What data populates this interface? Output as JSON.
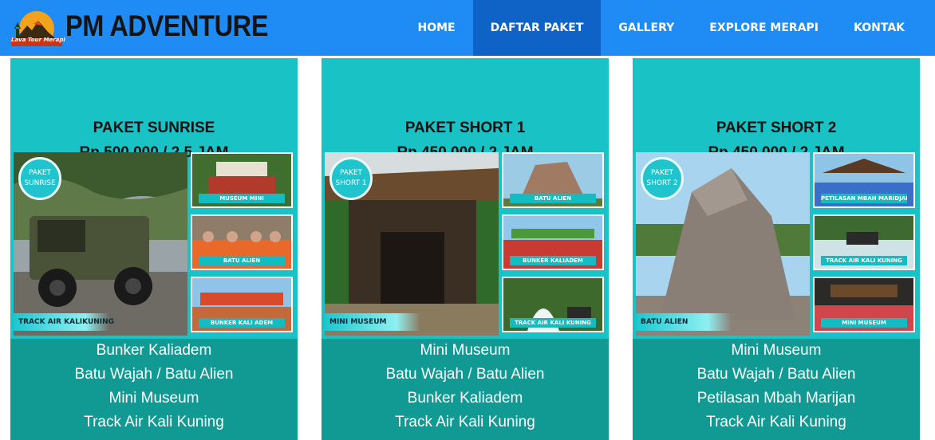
{
  "brand": {
    "name": "PM ADVENTURE",
    "tagline": "Lava Tour Merapi"
  },
  "nav": [
    {
      "label": "HOME",
      "active": false
    },
    {
      "label": "DAFTAR PAKET",
      "active": true
    },
    {
      "label": "GALLERY",
      "active": false
    },
    {
      "label": "EXPLORE MERAPI",
      "active": false
    },
    {
      "label": "KONTAK",
      "active": false
    }
  ],
  "cards": [
    {
      "title": "PAKET SUNRISE",
      "price": "Rp 500.000 / 2,5 JAM",
      "badge": [
        "PAKET",
        "SUNRISE"
      ],
      "main_caption": "TRACK AIR KALIKUNING",
      "thumbs": [
        "MUSEUM MINI",
        "BATU ALIEN",
        "BUNKER KALI ADEM"
      ],
      "items": [
        "Bunker Kaliadem",
        "Batu Wajah / Batu Alien",
        "Mini Museum",
        "Track Air Kali Kuning"
      ]
    },
    {
      "title": "PAKET SHORT 1",
      "price": "Rp 450.000 / 2 JAM",
      "badge": [
        "PAKET",
        "SHORT 1"
      ],
      "main_caption": "MINI MUSEUM",
      "thumbs": [
        "BATU ALIEN",
        "BUNKER KALIADEM",
        "TRACK AIR KALI KUNING"
      ],
      "items": [
        "Mini Museum",
        "Batu Wajah / Batu Alien",
        "Bunker Kaliadem",
        "Track Air Kali Kuning"
      ]
    },
    {
      "title": "PAKET SHORT 2",
      "price": "Rp 450.000 / 2 JAM",
      "badge": [
        "PAKET",
        "SHORT 2"
      ],
      "main_caption": "BATU ALIEN",
      "thumbs": [
        "PETILASAN MBAH MARIDJAN",
        "TRACK AIR KALI KUNING",
        "MINI MUSEUM"
      ],
      "items": [
        "Mini Museum",
        "Batu Wajah / Batu Alien",
        "Petilasan Mbah Marijan",
        "Track Air Kali Kuning"
      ]
    }
  ],
  "colors": {
    "navbar": "#1e8cf4",
    "nav_active": "#0f62c6",
    "card_top": "#18c2c5",
    "card_list": "#119a94"
  }
}
